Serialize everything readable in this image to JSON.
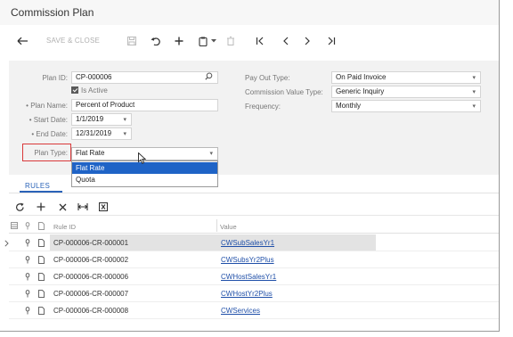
{
  "window": {
    "title": "Commission Plan"
  },
  "toolbar": {
    "save_close_label": "SAVE & CLOSE"
  },
  "form": {
    "plan_id": {
      "label": "Plan ID:",
      "value": "CP-000006"
    },
    "is_active": {
      "label": "Is Active",
      "checked": true
    },
    "plan_name": {
      "label": "• Plan Name:",
      "value": "Percent of Product"
    },
    "start_date": {
      "label": "• Start Date:",
      "value": "1/1/2019"
    },
    "end_date": {
      "label": "• End Date:",
      "value": "12/31/2019"
    },
    "plan_type": {
      "label": "Plan Type:",
      "value": "Flat Rate",
      "options": [
        "Flat Rate",
        "Quota"
      ],
      "highlighted_option": "Flat Rate"
    },
    "pay_out_type": {
      "label": "Pay Out Type:",
      "value": "On Paid Invoice"
    },
    "commission_value_type": {
      "label": "Commission Value Type:",
      "value": "Generic Inquiry"
    },
    "frequency": {
      "label": "Frequency:",
      "value": "Monthly"
    }
  },
  "tabs": [
    {
      "label": "RULES",
      "active": true
    }
  ],
  "grid": {
    "columns": [
      "Rule ID",
      "Value"
    ],
    "rows": [
      {
        "rule_id": "CP-000006-CR-000001",
        "value": "CWSubSalesYr1",
        "selected": true
      },
      {
        "rule_id": "CP-000006-CR-000002",
        "value": "CWSubsYr2Plus",
        "selected": false
      },
      {
        "rule_id": "CP-000006-CR-000006",
        "value": "CWHostSalesYr1",
        "selected": false
      },
      {
        "rule_id": "CP-000006-CR-000007",
        "value": "CWHostYr2Plus",
        "selected": false
      },
      {
        "rule_id": "CP-000006-CR-000008",
        "value": "CWServices",
        "selected": false
      }
    ]
  },
  "colors": {
    "accent": "#2a63b8",
    "link": "#1f4fa8",
    "highlight_option": "#1f63c6",
    "callout_red": "#d9393a"
  }
}
